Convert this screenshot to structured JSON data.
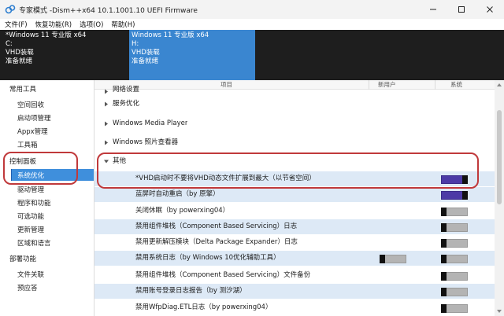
{
  "window": {
    "title": "专家模式 -Dism++x64 10.1.1001.10 UEFI Firmware",
    "icon": "dism-app-icon"
  },
  "menu": [
    "文件(F)",
    "恢复功能(R)",
    "选项(O)",
    "帮助(H)"
  ],
  "images": [
    {
      "name": "*Windows 11 专业版 x64",
      "drive": "C:",
      "type": "VHD装载",
      "status": "准备就绪",
      "selected": false
    },
    {
      "name": "Windows 11 专业版 x64",
      "drive": "H:",
      "type": "VHD装载",
      "status": "准备就绪",
      "selected": true
    }
  ],
  "sidebar": {
    "groups": [
      {
        "label": "常用工具",
        "items": [
          "空间回收",
          "启动项管理",
          "Appx管理",
          "工具箱"
        ]
      },
      {
        "label": "控制面板",
        "items": [
          "系统优化",
          "驱动管理",
          "程序和功能",
          "可选功能",
          "更新管理",
          "区域和语言"
        ]
      },
      {
        "label": "部署功能",
        "items": [
          "文件关联",
          "预应答"
        ]
      }
    ],
    "active_item": "系统优化"
  },
  "columns": {
    "item": "项目",
    "new_user": "新用户",
    "system": "系统"
  },
  "rows": [
    {
      "label": "网络设置",
      "kind": "category",
      "expanded": false
    },
    {
      "label": "服务优化",
      "kind": "category",
      "expanded": false
    },
    {
      "label": "Windows Media Player",
      "kind": "category",
      "expanded": false
    },
    {
      "label": "Windows 照片查看器",
      "kind": "category",
      "expanded": false
    },
    {
      "label": "其他",
      "kind": "category",
      "expanded": true
    },
    {
      "label": "*VHD启动时不要将VHD动态文件扩展到最大（以节省空间）",
      "kind": "setting",
      "alt": true,
      "new_user": null,
      "system": "on"
    },
    {
      "label": "蓝屏时自动重启（by 原擎）",
      "kind": "setting",
      "alt": true,
      "new_user": null,
      "system": "on"
    },
    {
      "label": "关闭休眠（by powerxing04）",
      "kind": "setting",
      "alt": false,
      "new_user": null,
      "system": "off"
    },
    {
      "label": "禁用组件堆栈（Component Based Servicing）日志",
      "kind": "setting",
      "alt": true,
      "new_user": null,
      "system": "off"
    },
    {
      "label": "禁用更新解压模块（Delta Package Expander）日志",
      "kind": "setting",
      "alt": false,
      "new_user": null,
      "system": "off"
    },
    {
      "label": "禁用系统日志（by Windows 10优化辅助工具）",
      "kind": "setting",
      "alt": true,
      "new_user": "off",
      "system": "off"
    },
    {
      "label": "禁用组件堆栈（Component Based Servicing）文件备份",
      "kind": "setting",
      "alt": false,
      "new_user": null,
      "system": "off"
    },
    {
      "label": "禁用账号登录日志报告（by 测汐湖）",
      "kind": "setting",
      "alt": true,
      "new_user": null,
      "system": "off"
    },
    {
      "label": "禁用WfpDiag.ETL日志（by powerxing04）",
      "kind": "setting",
      "alt": false,
      "new_user": null,
      "system": "off"
    }
  ],
  "colors": {
    "selected_image_bg": "#3a86d0",
    "image_bar_bg": "#1e1e1e",
    "sidebar_active_bg": "#3f8fdc",
    "row_alt_bg": "#dde9f6",
    "toggle_on": "#4c3aa6",
    "toggle_off": "#b4b4b4",
    "annotation_red": "#c0393b"
  }
}
